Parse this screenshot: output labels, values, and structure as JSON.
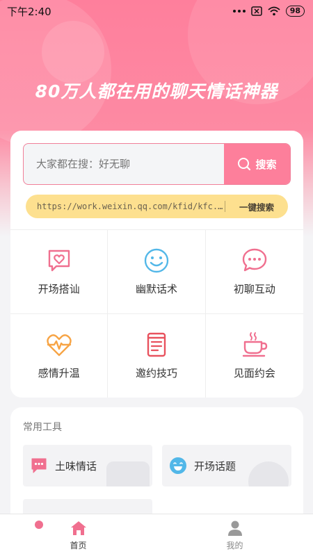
{
  "status_bar": {
    "time": "下午2:40",
    "battery": "98"
  },
  "hero": {
    "title": "80万人都在用的聊天情话神器"
  },
  "search": {
    "placeholder": "大家都在搜：好无聊",
    "button_label": "搜索"
  },
  "link_bar": {
    "url": "https://work.weixin.qq.com/kfid/kfc...",
    "button_label": "一键搜索"
  },
  "categories": [
    {
      "label": "开场搭讪",
      "icon": "heart-chat-icon"
    },
    {
      "label": "幽默话术",
      "icon": "smile-icon"
    },
    {
      "label": "初聊互动",
      "icon": "chat-dots-icon"
    },
    {
      "label": "感情升温",
      "icon": "heartbeat-icon"
    },
    {
      "label": "邀约技巧",
      "icon": "book-icon"
    },
    {
      "label": "见面约会",
      "icon": "coffee-icon"
    }
  ],
  "tools": {
    "title": "常用工具",
    "items": [
      {
        "label": "土味情话",
        "icon": "chat-bubble-icon"
      },
      {
        "label": "开场话题",
        "icon": "laugh-icon"
      }
    ]
  },
  "tabbar": {
    "items": [
      {
        "label": "首页",
        "icon": "home-icon",
        "active": true
      },
      {
        "label": "我的",
        "icon": "user-icon",
        "active": false
      }
    ]
  },
  "colors": {
    "brand_pink": "#fd7f9b",
    "accent_orange": "#f7a445",
    "accent_blue": "#52b7e8",
    "link_bar_bg": "#fde08f"
  }
}
